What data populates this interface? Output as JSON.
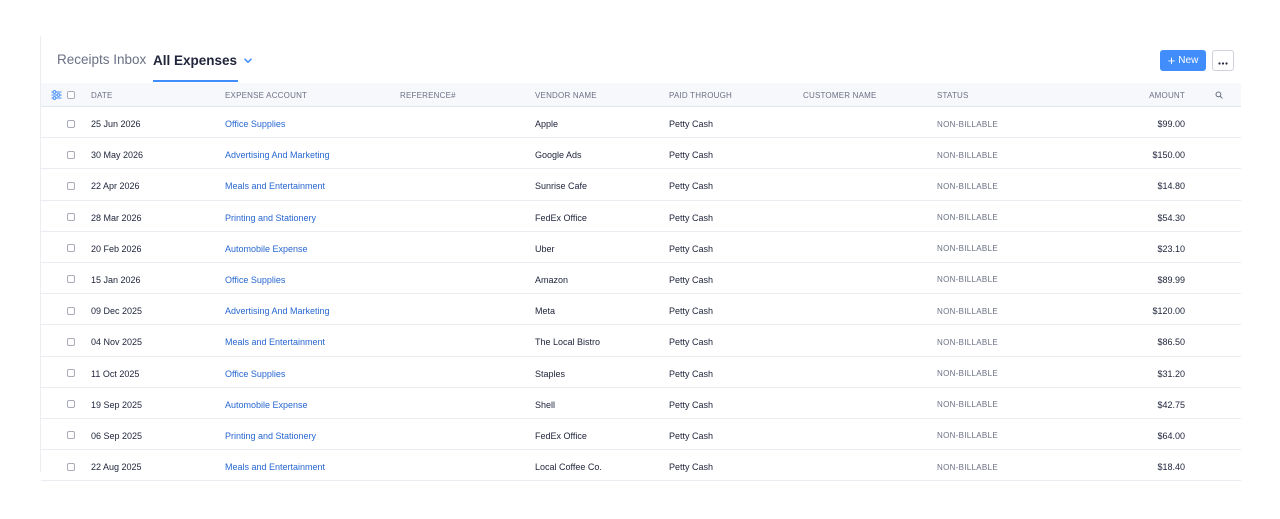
{
  "tabs": {
    "receipts_inbox": "Receipts Inbox",
    "all_expenses": "All Expenses"
  },
  "toolbar": {
    "new_label": "New",
    "more_icon": "ellipsis-icon"
  },
  "colors": {
    "accent": "#408dfb",
    "link": "#2767d1",
    "muted": "#6b7084"
  },
  "table": {
    "columns": {
      "date": "DATE",
      "expense_account": "EXPENSE ACCOUNT",
      "reference": "REFERENCE#",
      "vendor_name": "VENDOR NAME",
      "paid_through": "PAID THROUGH",
      "customer_name": "CUSTOMER NAME",
      "status": "STATUS",
      "amount": "AMOUNT"
    },
    "rows": [
      {
        "date": "25 Jun 2026",
        "account": "Office Supplies",
        "reference": "",
        "vendor": "Apple",
        "paid": "Petty Cash",
        "customer": "",
        "status": "NON-BILLABLE",
        "amount": "$99.00"
      },
      {
        "date": "30 May 2026",
        "account": "Advertising And Marketing",
        "reference": "",
        "vendor": "Google Ads",
        "paid": "Petty Cash",
        "customer": "",
        "status": "NON-BILLABLE",
        "amount": "$150.00"
      },
      {
        "date": "22 Apr 2026",
        "account": "Meals and Entertainment",
        "reference": "",
        "vendor": "Sunrise Cafe",
        "paid": "Petty Cash",
        "customer": "",
        "status": "NON-BILLABLE",
        "amount": "$14.80"
      },
      {
        "date": "28 Mar 2026",
        "account": "Printing and Stationery",
        "reference": "",
        "vendor": "FedEx Office",
        "paid": "Petty Cash",
        "customer": "",
        "status": "NON-BILLABLE",
        "amount": "$54.30"
      },
      {
        "date": "20 Feb 2026",
        "account": "Automobile Expense",
        "reference": "",
        "vendor": "Uber",
        "paid": "Petty Cash",
        "customer": "",
        "status": "NON-BILLABLE",
        "amount": "$23.10"
      },
      {
        "date": "15 Jan 2026",
        "account": "Office Supplies",
        "reference": "",
        "vendor": "Amazon",
        "paid": "Petty Cash",
        "customer": "",
        "status": "NON-BILLABLE",
        "amount": "$89.99"
      },
      {
        "date": "09 Dec 2025",
        "account": "Advertising And Marketing",
        "reference": "",
        "vendor": "Meta",
        "paid": "Petty Cash",
        "customer": "",
        "status": "NON-BILLABLE",
        "amount": "$120.00"
      },
      {
        "date": "04 Nov 2025",
        "account": "Meals and Entertainment",
        "reference": "",
        "vendor": "The Local Bistro",
        "paid": "Petty Cash",
        "customer": "",
        "status": "NON-BILLABLE",
        "amount": "$86.50"
      },
      {
        "date": "11 Oct 2025",
        "account": "Office Supplies",
        "reference": "",
        "vendor": "Staples",
        "paid": "Petty Cash",
        "customer": "",
        "status": "NON-BILLABLE",
        "amount": "$31.20"
      },
      {
        "date": "19 Sep 2025",
        "account": "Automobile Expense",
        "reference": "",
        "vendor": "Shell",
        "paid": "Petty Cash",
        "customer": "",
        "status": "NON-BILLABLE",
        "amount": "$42.75"
      },
      {
        "date": "06 Sep 2025",
        "account": "Printing and Stationery",
        "reference": "",
        "vendor": "FedEx Office",
        "paid": "Petty Cash",
        "customer": "",
        "status": "NON-BILLABLE",
        "amount": "$64.00"
      },
      {
        "date": "22 Aug 2025",
        "account": "Meals and Entertainment",
        "reference": "",
        "vendor": "Local Coffee Co.",
        "paid": "Petty Cash",
        "customer": "",
        "status": "NON-BILLABLE",
        "amount": "$18.40"
      }
    ]
  }
}
